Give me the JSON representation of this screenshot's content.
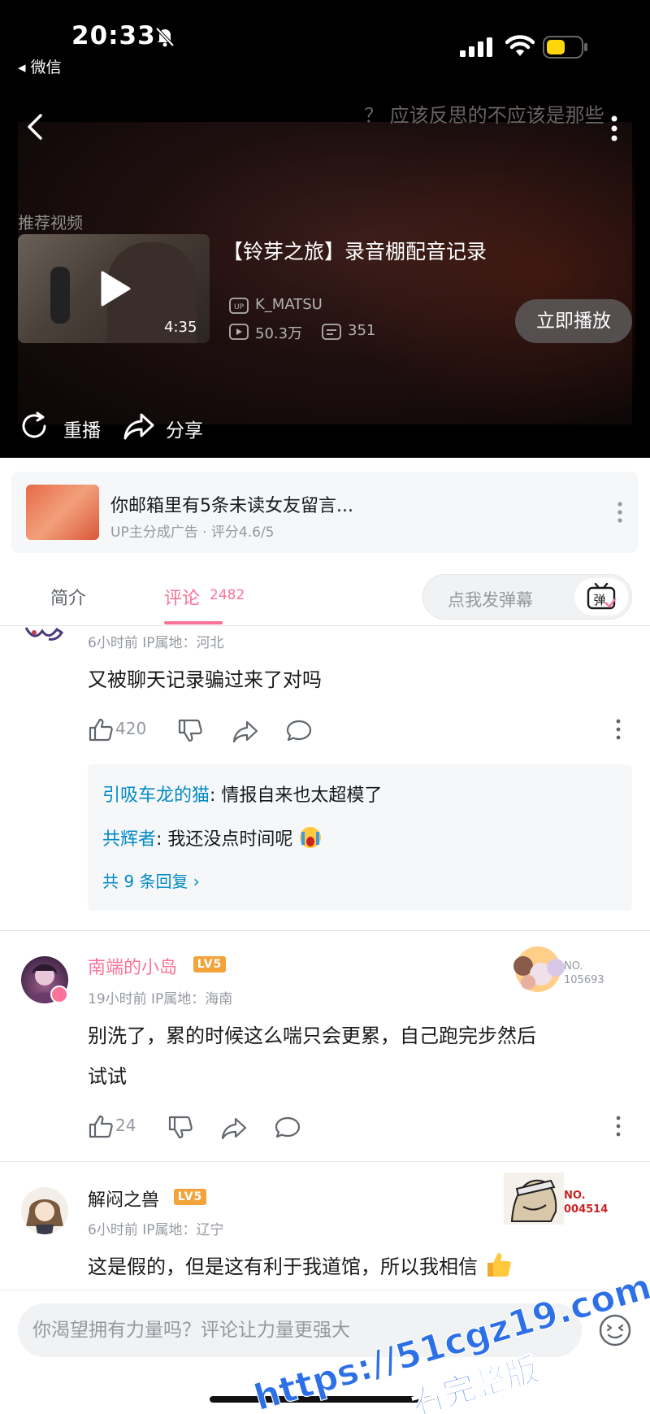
{
  "status_bar": {
    "time": "20:33",
    "back_app": "◂ 微信"
  },
  "player": {
    "bg_danmaku": "？ 应该反思的不应该是那些"
  },
  "recommend": {
    "label": "推荐视频",
    "duration": "4:35",
    "title": "【铃芽之旅】录音棚配音记录",
    "up_name": "K_MATSU",
    "views": "50.3万",
    "danmaku_count": "351",
    "play_now_label": "立即播放"
  },
  "player_actions": {
    "replay_label": "重播",
    "share_label": "分享"
  },
  "ad": {
    "title": "你邮箱里有5条未读女友留言...",
    "meta": "UP主分成广告 · 评分4.6/5"
  },
  "tabs": {
    "intro_label": "简介",
    "comment_label": "评论",
    "comment_count": "2482",
    "danmaku_placeholder": "点我发弹幕",
    "danmaku_button_glyph": "弹"
  },
  "comments": [
    {
      "time": "6小时前  IP属地：河北",
      "text": "又被聊天记录骗过来了对吗",
      "likes": "420",
      "replies": [
        {
          "name": "引吸车龙的猫",
          "body": ": 情报自来也太超模了"
        },
        {
          "name": "共辉者",
          "body": ": 我还没点时间呢"
        }
      ],
      "more_replies": "共 9 条回复 ›"
    },
    {
      "name": "南端的小岛",
      "level": "LV5",
      "time": "19小时前  IP属地：海南",
      "text_line1": "别洗了，累的时候这么喘只会更累，自己跑完步然后",
      "text_line2": "试试",
      "likes": "24",
      "fan_no_line1": "NO.",
      "fan_no_line2": "105693"
    },
    {
      "name": "解闷之兽",
      "level": "LV5",
      "time": "6小时前  IP属地：辽宁",
      "text": "这是假的，但是这有利于我道馆，所以我相信",
      "fan_no_line1": "NO.",
      "fan_no_line2": "004514"
    }
  ],
  "input": {
    "placeholder": "你渴望拥有力量吗？评论让力量更强大"
  },
  "watermark": {
    "line1": "https://51cgz19.com",
    "line2": "看完整版"
  },
  "colors": {
    "accent_pink": "#fb7299",
    "link_blue": "#008ac5",
    "level_orange": "#f2a33a"
  }
}
